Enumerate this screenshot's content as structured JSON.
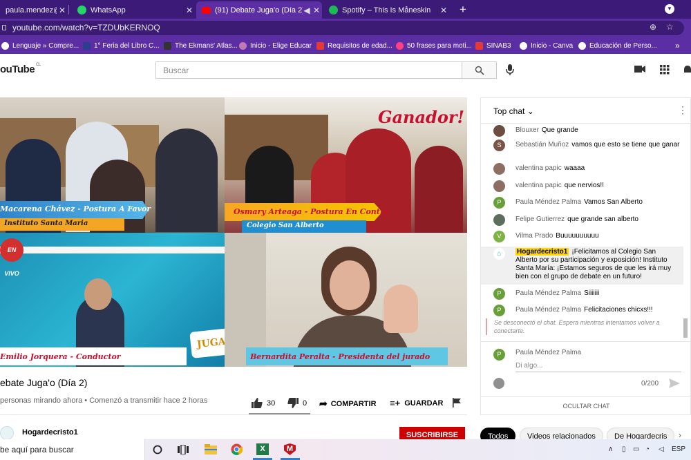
{
  "browser": {
    "tabs": [
      {
        "title": "paula.mendez@san",
        "active": false
      },
      {
        "title": "WhatsApp",
        "active": false
      },
      {
        "title": "(91) Debate Juga'o (Día 2) - ",
        "active": true
      },
      {
        "title": "Spotify – This Is Måneskin",
        "active": false
      }
    ],
    "url": "youtube.com/watch?v=TZDUbKERNOQ",
    "bookmarks": [
      "Lenguaje » Compre...",
      "1° Feria del Libro C...",
      "The Ekmans' Atlas...",
      "Inicio - Elige Educar",
      "Requisitos de edad...",
      "50 frases para moti...",
      "SINAB3",
      "Inicio - Canva",
      "Educación de Perso..."
    ],
    "colors": {
      "frame": "#3c1a78",
      "toolbar": "#5b2ea3"
    }
  },
  "youtube": {
    "logo": "ouTube",
    "region": "CL",
    "search_placeholder": "Buscar"
  },
  "video": {
    "participants": [
      {
        "name": "Macarena Chávez - Postura A Favor",
        "school": "Instituto Santa Maria"
      },
      {
        "name": "Osmary Arteaga - Postura En Contra",
        "school": "Colegio San Alberto"
      },
      {
        "name": "Emilio Jorquera - Conductor"
      },
      {
        "name": "Bernardita Peralta - Presidenta del jurado"
      }
    ],
    "winner_label": "Ganador!",
    "live_label": "EN VIVO",
    "brand_logo": "JUGA'O",
    "title": "ebate Juga'o (Día 2)",
    "meta": "personas mirando ahora • Comenzó a transmitir hace 2 horas",
    "likes": "30",
    "dislikes": "0",
    "share_label": "COMPARTIR",
    "save_label": "GUARDAR",
    "channel": "Hogardecristo1",
    "subscribe_label": "SUSCRIBIRSE"
  },
  "chat": {
    "header": "Top chat",
    "messages": [
      {
        "author": "Blouxer",
        "text": "Que grande",
        "avatar_color": "#6d4c41"
      },
      {
        "author": "Sebastián Muñoz",
        "text": "vamos que esto se tiene que ganar",
        "avatar_color": "#795548",
        "initial": "S"
      },
      {
        "author": "valentina papic",
        "text": "waaaa",
        "avatar_color": "#8d6e63"
      },
      {
        "author": "valentina papic",
        "text": "que nervios!!",
        "avatar_color": "#8d6e63"
      },
      {
        "author": "Paula Méndez Palma",
        "text": "Vamos San Alberto",
        "avatar_color": "#689f38",
        "initial": "P"
      },
      {
        "author": "Felipe Gutierrez",
        "text": "que grande san alberto",
        "avatar_color": "#5d6d5e"
      },
      {
        "author": "Vilma Prado",
        "text": "Buuuuuuuuuu",
        "avatar_color": "#7cb342",
        "initial": "V"
      },
      {
        "author": "Hogardecristo1",
        "text": "¡Felicitamos al Colegio San Alberto por su participación y exposición! Instituto Santa María: ¡Estamos seguros de que les irá muy bien con el grupo de debate en un futuro!",
        "avatar_color": "#ffffff",
        "owner": true
      },
      {
        "author": "Paula Méndez Palma",
        "text": "Siiiiiii",
        "avatar_color": "#689f38",
        "initial": "P"
      },
      {
        "author": "Paula Méndez Palma",
        "text": "Felicitaciones chicxs!!!",
        "avatar_color": "#689f38",
        "initial": "P"
      }
    ],
    "disconnected": "Se desconectó el chat. Espera mientras intentamos volver a conectarte.",
    "composer_user": "Paula Méndez Palma",
    "composer_initial": "P",
    "composer_placeholder": "Di algo...",
    "char_count": "0/200",
    "hide_label": "OCULTAR CHAT"
  },
  "chips": [
    "Todos",
    "Videos relacionados",
    "De Hogardecris"
  ],
  "taskbar": {
    "search_text": "be aquí para buscar",
    "lang": "ESP"
  }
}
